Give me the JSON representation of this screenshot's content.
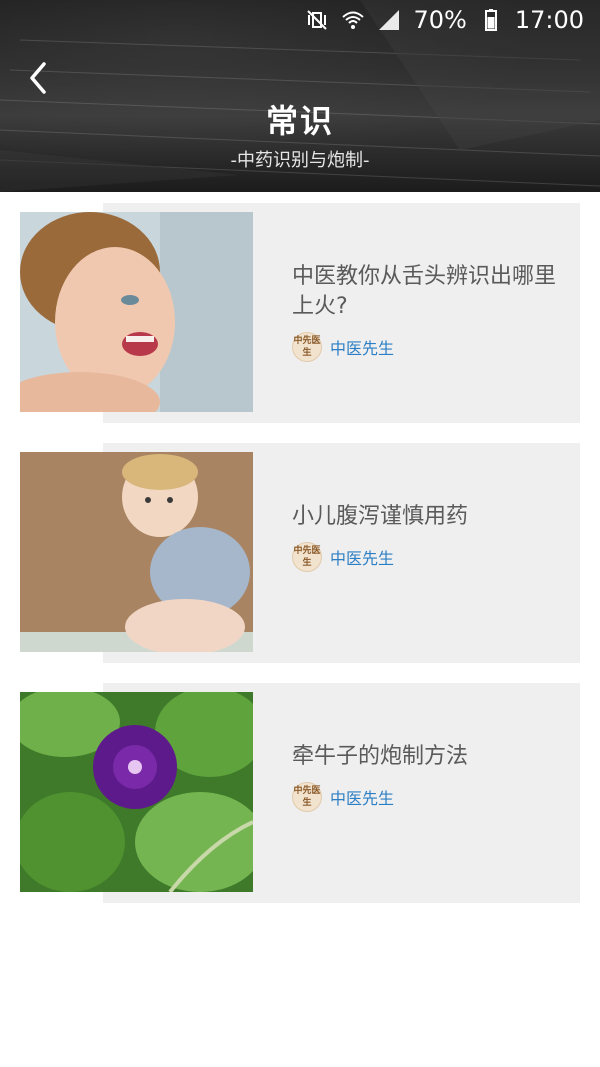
{
  "status_bar": {
    "battery": "70%",
    "time": "17:00",
    "icons": [
      "mute-vibrate-icon",
      "wifi-icon",
      "signal-icon",
      "battery-icon"
    ]
  },
  "header": {
    "title": "常识",
    "subtitle": "-中药识别与炮制-"
  },
  "articles": [
    {
      "title": "中医教你从舌头辨识出哪里上火?",
      "author": "中医先生",
      "avatar_text": "中先医生"
    },
    {
      "title": "小儿腹泻谨慎用药",
      "author": "中医先生",
      "avatar_text": "中先医生"
    },
    {
      "title": "牵牛子的炮制方法",
      "author": "中医先生",
      "avatar_text": "中先医生"
    }
  ],
  "colors": {
    "accent": "#2c7fc4",
    "card_bg": "#efefef",
    "title_text": "#5a5a5a"
  }
}
